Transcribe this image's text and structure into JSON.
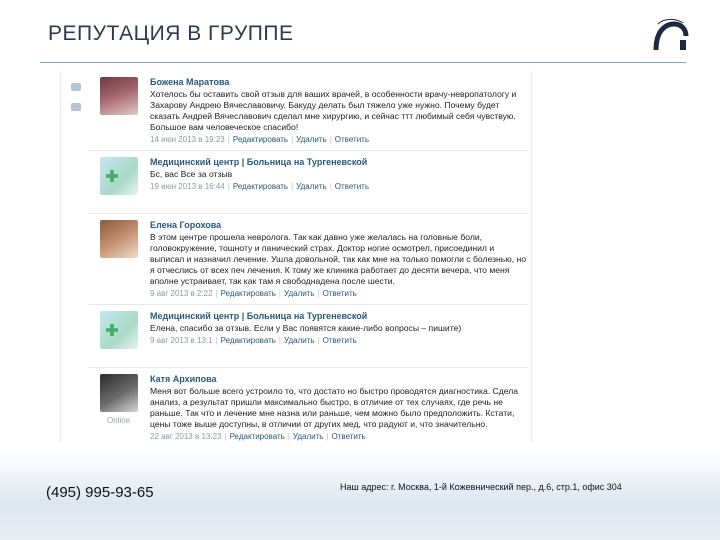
{
  "slide": {
    "title": "РЕПУТАЦИЯ В ГРУППЕ"
  },
  "posts": [
    {
      "author": "Божена Маратова",
      "text": "Хотелось бы оставить свой отзыв для ваших врачей, в особенности врачу-невропатологу и Захарову Андрею Вячеславовичу. Бакуду делать был тяжело уже нужно. Почему будет сказать Андрей Вячеславович сделал мне хирургию, и сейчас ттт любимый себя чувствую. Большое вам человеческое спасибо!",
      "date": "14 июн 2013 в 19:23",
      "edit": "Редактировать",
      "delete": "Удалить",
      "reply": "Ответить",
      "avatar": "woman-photo"
    },
    {
      "author": "Медицинский центр | Больница на Тургеневской",
      "text": "Бс, вас Все за отзыв",
      "date": "19 июн 2013 в 16:44",
      "edit": "Редактировать",
      "delete": "Удалить",
      "reply": "Ответить",
      "avatar": "clinic-logo"
    },
    {
      "author": "Елена Горохова",
      "text": "В этом центре прошела невролога. Так как давно уже желалась на головные боли, головокружение, тошноту и панический страх. Доктор ногие осмотрел, присоединил и выписал и назначил лечение. Ушла довольной, так как мне на только помогли с болезнью, но я отчеслись от всех печ лечения. К тому же клиника работает до десяти вечера, что меня вполне устраивает, так как там я свободнадена после шести.",
      "date": "9 авг 2013 в 2:22",
      "edit": "Редактировать",
      "delete": "Удалить",
      "reply": "Ответить",
      "avatar": "woman-photo"
    },
    {
      "author": "Медицинский центр | Больница на Тургеневской",
      "text": "Елена, спасибо за отзыв. Если у Вас появятся какие-либо вопросы – пишите)",
      "date": "9 авг 2013 в 13:1",
      "edit": "Редактировать",
      "delete": "Удалить",
      "reply": "Ответить",
      "avatar": "clinic-logo"
    },
    {
      "author": "Катя Архипова",
      "text": "Меня вот больше всего устроило то, что достато но быстро проводятся диагностика. Сдела анализ, а результат пришли максимально быстро, в отличие от тех случаях, где речь не раньше. Так что и лечение мне назна или раньше, чем можно было предположить. Кстати, цены тоже выше доступны, в отличии от других мед, что радуют и, что значительно.",
      "date": "22 авг 2013 в 13:23",
      "edit": "Редактировать",
      "delete": "Удалить",
      "reply": "Ответить",
      "avatar": "woman-photo",
      "status": "Online"
    }
  ],
  "footer": {
    "phone": "(495) 995-93-65",
    "address": "Наш адрес: г. Москва, 1-й Кожевнический пер., д.6, стр.1, офис 304"
  },
  "colors": {
    "title": "#2b3a52",
    "link": "#2b587a",
    "meta": "#8c98a6",
    "rule": "#7fa7c9"
  }
}
